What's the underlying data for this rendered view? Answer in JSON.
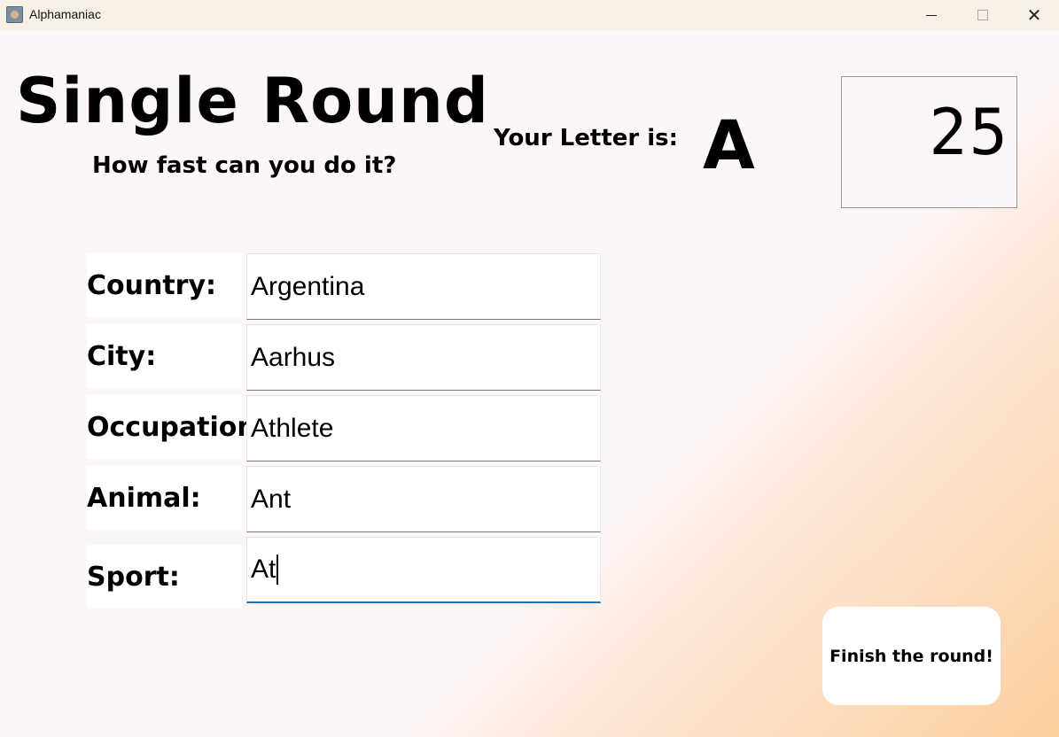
{
  "window": {
    "title": "Alphamaniac",
    "app_icon": "app-icon",
    "controls": {
      "minimize_icon": "minimize-icon",
      "maximize_icon": "maximize-icon",
      "close_icon": "close-icon",
      "close_glyph": "✕"
    }
  },
  "header": {
    "title": "Single Round",
    "subtitle": "How fast can you do it?",
    "letter_label": "Your Letter is:",
    "letter_value": "A",
    "timer_value": "25"
  },
  "form": {
    "fields": [
      {
        "label": "Country:",
        "value": "Argentina"
      },
      {
        "label": "City:",
        "value": "Aarhus"
      },
      {
        "label": "Occupation:",
        "value": "Athlete"
      },
      {
        "label": "Animal:",
        "value": "Ant"
      },
      {
        "label": "Sport:",
        "value": "At"
      }
    ]
  },
  "actions": {
    "finish_label": "Finish the round!"
  },
  "colors": {
    "accent_focus": "#1a6fc7",
    "background": "#fdf6f8",
    "gradient_peach": "#fccf9e"
  }
}
